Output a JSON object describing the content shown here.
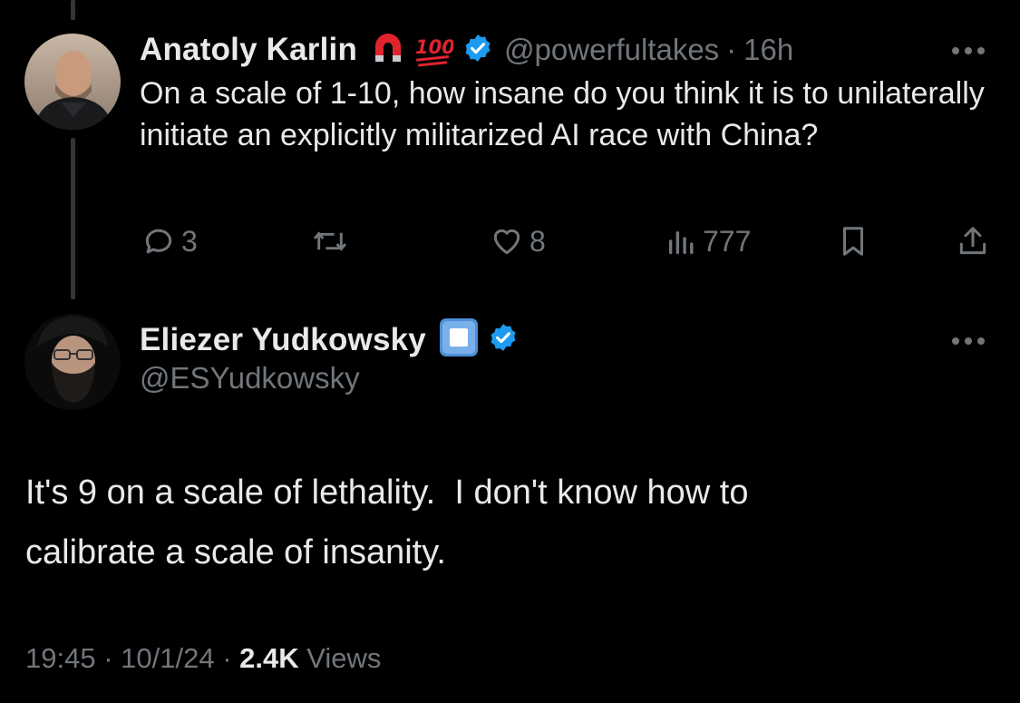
{
  "colors": {
    "background": "#000000",
    "text": "#e7e9ea",
    "secondary": "#71767b",
    "verified": "#1d9bf0"
  },
  "reply": {
    "author_name": "Anatoly Karlin",
    "emoji_icons": [
      "magnet-icon",
      "hundred-points-icon"
    ],
    "handle": "@powerfultakes",
    "separator": "·",
    "time_ago": "16h",
    "text": "On a scale of 1-10, how insane do you think it is to unilaterally initiate an explicitly militarized AI race with China?",
    "actions": {
      "replies_icon": "reply-icon",
      "replies": "3",
      "retweet_icon": "retweet-icon",
      "likes_icon": "heart-icon",
      "likes": "8",
      "views_icon": "views-icon",
      "views": "777",
      "bookmark_icon": "bookmark-icon",
      "share_icon": "share-icon"
    }
  },
  "main": {
    "author_name": "Eliezer Yudkowsky",
    "emoji_icons": [
      "stop-button-icon"
    ],
    "handle": "@ESYudkowsky",
    "text": "It's 9 on a scale of lethality.  I don't know how to\ncalibrate a scale of insanity.",
    "time": "19:45",
    "sep1": "·",
    "date": "10/1/24",
    "sep2": "·",
    "views_count": "2.4K",
    "views_label": "Views"
  }
}
